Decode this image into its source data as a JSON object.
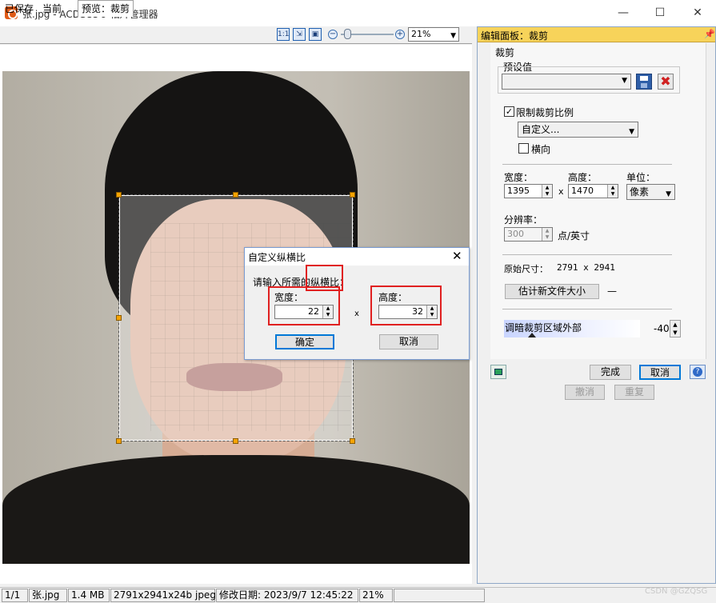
{
  "window": {
    "title": "张.jpg - ACDSee 9 相片管理器",
    "minimize": "—",
    "maximize": "☐",
    "close": "✕"
  },
  "tabs": [
    "已保存",
    "当前",
    "预览：裁剪"
  ],
  "toolbar": {
    "zoom_value": "21%",
    "icons": [
      "one-to-one-icon",
      "fit-image-icon",
      "fit-window-icon"
    ]
  },
  "panel": {
    "title": "编辑面板：裁剪",
    "section": "裁剪",
    "preset_label": "预设值",
    "preset_value": "",
    "limit_ratio_label": "限制裁剪比例",
    "limit_ratio_checked": true,
    "ratio_select": "自定义...",
    "landscape_label": "横向",
    "landscape_checked": false,
    "width_label": "宽度：",
    "width_value": "1395",
    "height_label": "高度：",
    "height_value": "1470",
    "unit_label": "单位：",
    "unit_value": "像素",
    "times": "x",
    "resolution_label": "分辨率：",
    "resolution_value": "300",
    "resolution_unit": "点/英寸",
    "original_size_label": "原始尺寸：",
    "original_size_value": "2791 x 2941",
    "estimate_button": "估计新文件大小",
    "estimate_result": "—",
    "darken_label": "调暗裁剪区域外部",
    "darken_value": "-40",
    "done_button": "完成",
    "cancel_button": "取消",
    "undo_button": "撤消",
    "redo_button": "重复"
  },
  "dialog": {
    "title": "自定义纵横比",
    "prompt": "请输入所需的纵横比：",
    "width_label": "宽度：",
    "width_value": "22",
    "height_label": "高度：",
    "height_value": "32",
    "times": "x",
    "ok_button": "确定",
    "cancel_button": "取消"
  },
  "status": {
    "index": "1/1",
    "filename": "张.jpg",
    "filesize": "1.4 MB",
    "dimensions": "2791x2941x24b jpeg",
    "modified": "修改日期: 2023/9/7 12:45:22",
    "zoom": "21%"
  },
  "watermark": "CSDN @GZQSG"
}
